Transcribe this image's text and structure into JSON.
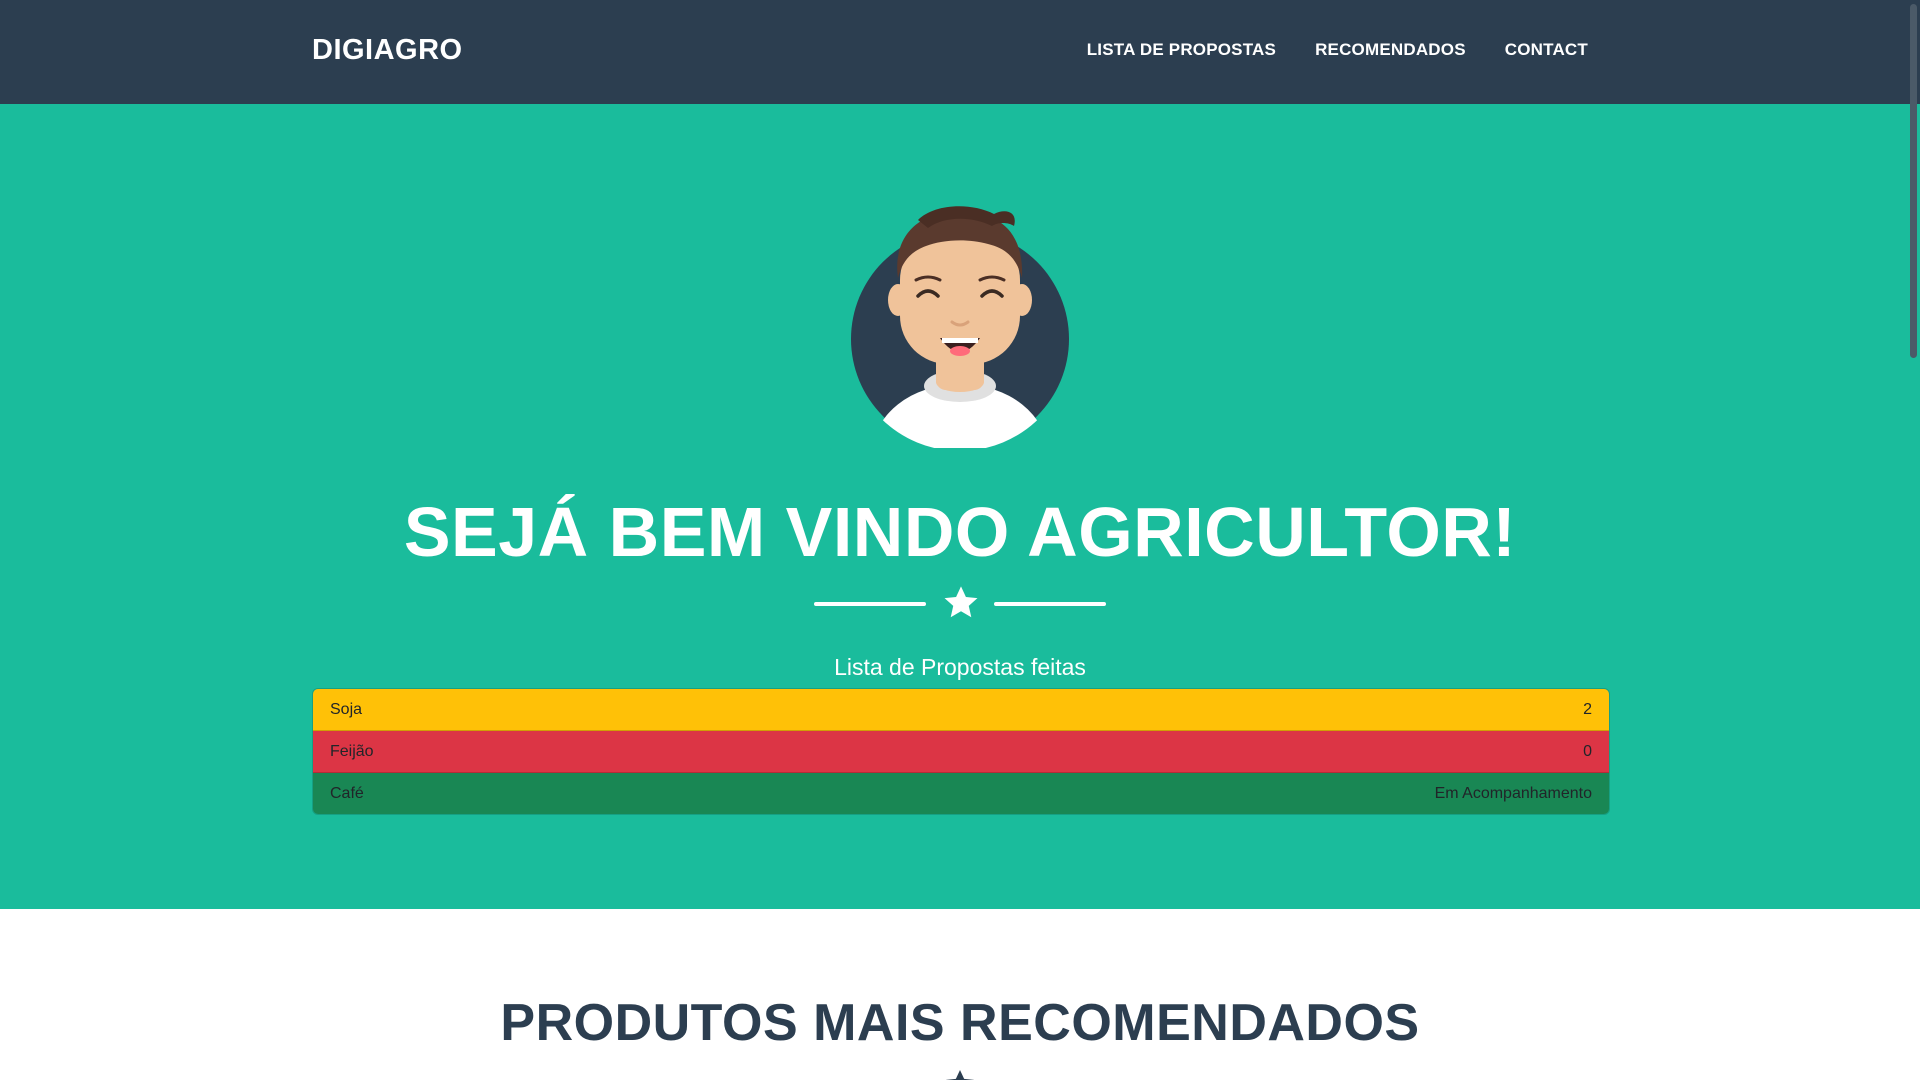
{
  "navbar": {
    "brand": "DIGIAGRO",
    "links": [
      {
        "label": "LISTA DE PROPOSTAS"
      },
      {
        "label": "RECOMENDADOS"
      },
      {
        "label": "CONTACT"
      }
    ]
  },
  "hero": {
    "avatar_icon": "farmer-avatar-icon",
    "title": "SEJÁ BEM VINDO AGRICULTOR!",
    "divider_icon": "star-icon",
    "list_title": "Lista de Propostas feitas",
    "proposals": [
      {
        "name": "Soja",
        "status": "2",
        "color": "#ffc107"
      },
      {
        "name": "Feijão",
        "status": "0",
        "color": "#dc3545"
      },
      {
        "name": "Café",
        "status": "Em Acompanhamento",
        "color": "#198754"
      }
    ]
  },
  "section": {
    "title": "PRODUTOS MAIS RECOMENDADOS",
    "divider_icon": "star-icon"
  },
  "colors": {
    "navbar_bg": "#2c3e50",
    "hero_bg": "#1abc9c",
    "text_light": "#ffffff",
    "text_dark": "#2c3e50"
  }
}
